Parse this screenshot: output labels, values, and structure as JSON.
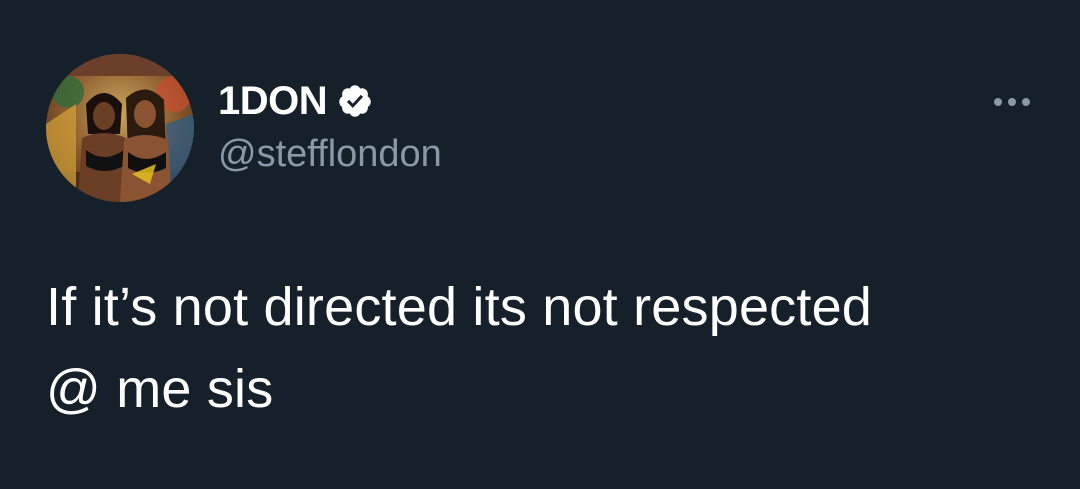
{
  "tweet": {
    "author": {
      "display_name": "1DON",
      "handle": "@stefflondon",
      "verified": true,
      "avatar_icon": "profile-photo"
    },
    "more_icon": "more-horizontal-icon",
    "text_lines": [
      "If it’s not directed its not respected",
      "@ me sis"
    ]
  },
  "colors": {
    "background": "#15202b",
    "primary_text": "#ffffff",
    "secondary_text": "#8b98a5",
    "verified_badge": "#ffffff"
  }
}
